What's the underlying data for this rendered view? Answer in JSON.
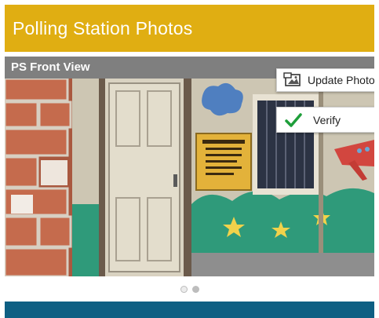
{
  "app": {
    "title": "Polling Station Photos"
  },
  "section": {
    "title": "PS Front View"
  },
  "actions": {
    "update_label": "Update Photo",
    "verify_label": "Verify",
    "update_icon": "camera-photo-icon",
    "verify_icon": "checkmark-icon"
  },
  "carousel": {
    "page_count": 2,
    "active_index": 0
  },
  "colors": {
    "appbar": "#e0ae12",
    "section_header": "#7f7f7f",
    "verify_check": "#1e9e3a",
    "bottom_strip": "#0e5f83"
  }
}
